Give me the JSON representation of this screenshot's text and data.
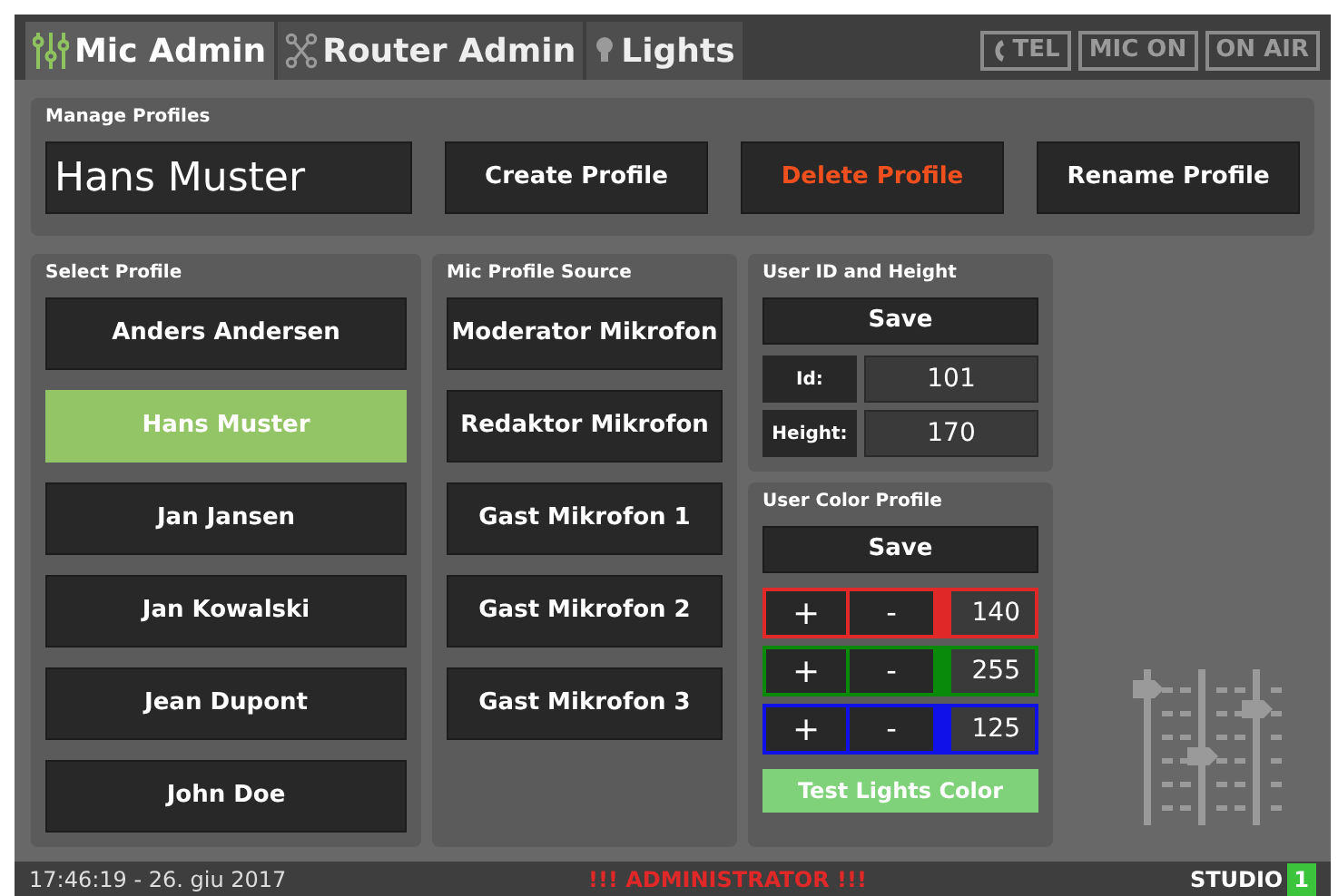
{
  "tabs": [
    {
      "label": "Mic Admin",
      "selected": true
    },
    {
      "label": "Router Admin",
      "selected": false
    },
    {
      "label": "Lights",
      "selected": false
    }
  ],
  "indicators": [
    {
      "label": "TEL",
      "on": false
    },
    {
      "label": "MIC ON",
      "on": false
    },
    {
      "label": "ON AIR",
      "on": false
    }
  ],
  "manage_profiles": {
    "title": "Manage Profiles",
    "name_value": "Hans Muster",
    "buttons": [
      {
        "label": "Create Profile",
        "kind": "normal"
      },
      {
        "label": "Delete Profile",
        "kind": "danger"
      },
      {
        "label": "Rename Profile",
        "kind": "normal"
      }
    ]
  },
  "select_profile": {
    "title": "Select Profile",
    "items": [
      {
        "label": "Anders Andersen",
        "selected": false
      },
      {
        "label": "Hans Muster",
        "selected": true
      },
      {
        "label": "Jan Jansen",
        "selected": false
      },
      {
        "label": "Jan Kowalski",
        "selected": false
      },
      {
        "label": "Jean Dupont",
        "selected": false
      },
      {
        "label": "John Doe",
        "selected": false
      }
    ]
  },
  "mic_profile_source": {
    "title": "Mic Profile Source",
    "items": [
      {
        "label": "Moderator Mikrofon"
      },
      {
        "label": "Redaktor Mikrofon"
      },
      {
        "label": "Gast Mikrofon 1"
      },
      {
        "label": "Gast Mikrofon 2"
      },
      {
        "label": "Gast Mikrofon 3"
      }
    ]
  },
  "user_id_height": {
    "title": "User ID and Height",
    "save": "Save",
    "fields": [
      {
        "label": "Id:",
        "value": "101"
      },
      {
        "label": "Height:",
        "value": "170"
      }
    ]
  },
  "user_color_profile": {
    "title": "User Color Profile",
    "save": "Save",
    "channels": [
      {
        "plus": "+",
        "minus": "-",
        "value": "140",
        "color": "#e02828"
      },
      {
        "plus": "+",
        "minus": "-",
        "value": "255",
        "color": "#0a8a0a"
      },
      {
        "plus": "+",
        "minus": "-",
        "value": "125",
        "color": "#1010e8"
      }
    ],
    "test_button": "Test Lights Color"
  },
  "status_bar": {
    "datetime": "17:46:19 - 26. giu 2017",
    "role": "!!! ADMINISTRATOR !!!",
    "studio": "STUDIO",
    "studio_number": "1"
  }
}
